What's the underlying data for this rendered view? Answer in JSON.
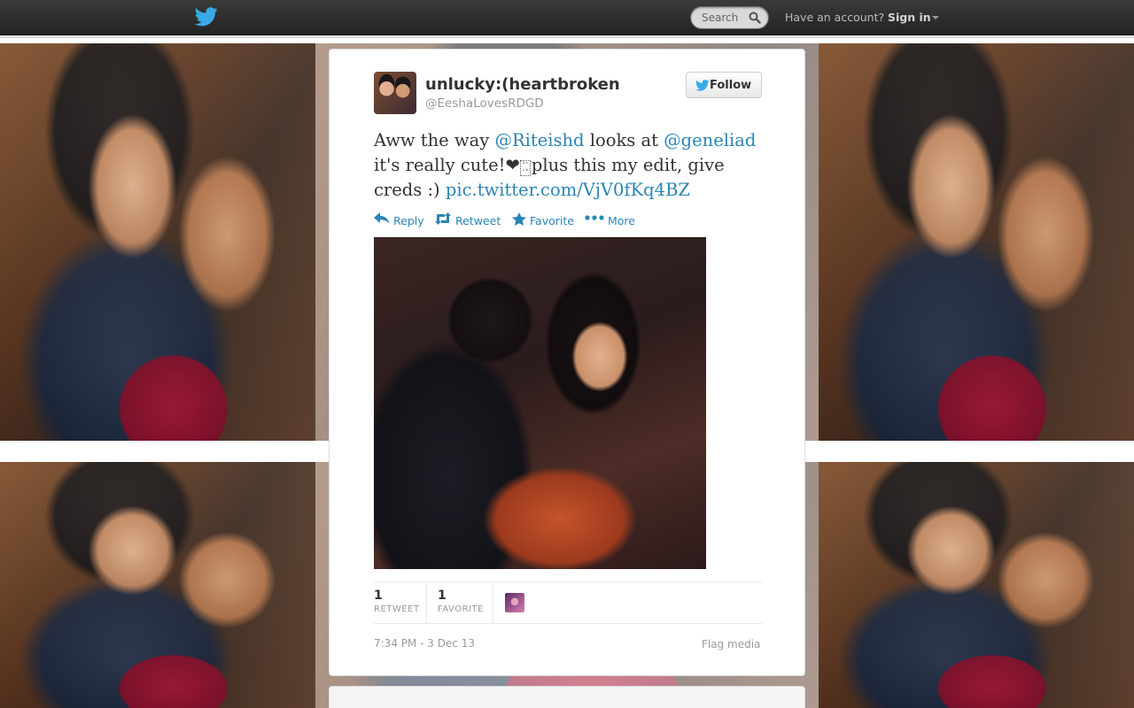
{
  "topbar": {
    "search_placeholder": "Search",
    "have_account": "Have an account?",
    "sign_in": "Sign in"
  },
  "tweet": {
    "display_name": "unlucky:(heartbroken",
    "screen_name": "@EeshaLovesRDGD",
    "follow_label": "Follow",
    "text": {
      "part1": "Aww the way ",
      "mention1": "@Riteishd",
      "part2": " looks at ",
      "mention2": "@geneliad",
      "part3": " it's really cute!",
      "heart": "❤",
      "box_glyph_top": "ᵁˢ",
      "box_glyph_bottom": "ⁱ⁶",
      "part4": "plus this my edit, give creds :) ",
      "link": "pic.twitter.com/VjV0fKq4BZ"
    },
    "actions": {
      "reply": "Reply",
      "retweet": "Retweet",
      "favorite": "Favorite",
      "more": "More"
    },
    "stats": {
      "retweet_count": "1",
      "retweet_label": "RETWEET",
      "favorite_count": "1",
      "favorite_label": "FAVORITE"
    },
    "timestamp": "7:34 PM - 3 Dec 13",
    "flag_media": "Flag media"
  },
  "colors": {
    "link": "#2a85b3",
    "topbar": "#2b2b2b",
    "twitter_blue": "#3aa9e8"
  },
  "icons": [
    "twitter-bird-icon",
    "search-icon",
    "caret-down-icon",
    "reply-icon",
    "retweet-icon",
    "star-icon",
    "more-dots-icon"
  ]
}
